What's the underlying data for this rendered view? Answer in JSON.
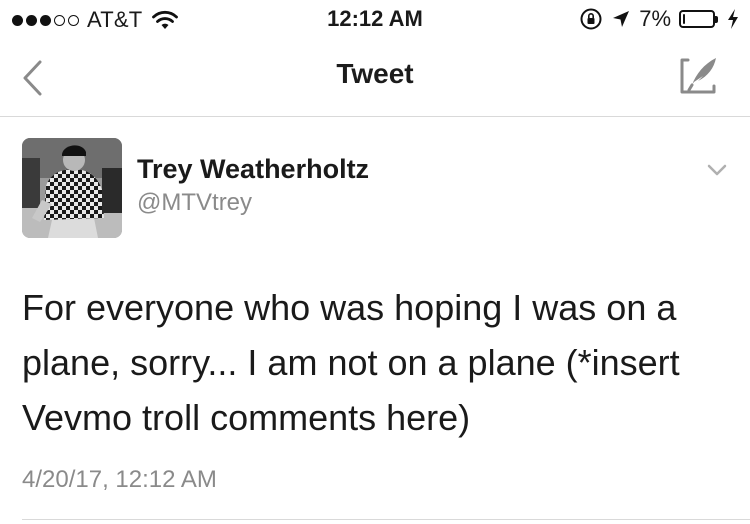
{
  "status_bar": {
    "carrier": "AT&T",
    "signal_bars": 5,
    "signal_filled": 3,
    "time": "12:12 AM",
    "battery_percent": "7%",
    "battery_level": 0.07,
    "icons": [
      "wifi-icon",
      "rotation-lock-icon",
      "location-arrow-icon",
      "battery-icon",
      "charging-bolt-icon"
    ]
  },
  "nav": {
    "title": "Tweet",
    "back_icon": "chevron-left-icon",
    "compose_icon": "compose-tweet-icon"
  },
  "tweet": {
    "author_name": "Trey Weatherholtz",
    "author_handle": "@MTVtrey",
    "text": "For everyone who was hoping I was on a plane, sorry... I am not on a plane (*insert Vevmo troll comments here)",
    "timestamp": "4/20/17, 12:12 AM",
    "menu_icon": "chevron-down-icon"
  },
  "colors": {
    "text_primary": "#1a1a1a",
    "text_secondary": "#8a8a8a",
    "divider": "#d9d9d9",
    "background": "#ffffff"
  }
}
